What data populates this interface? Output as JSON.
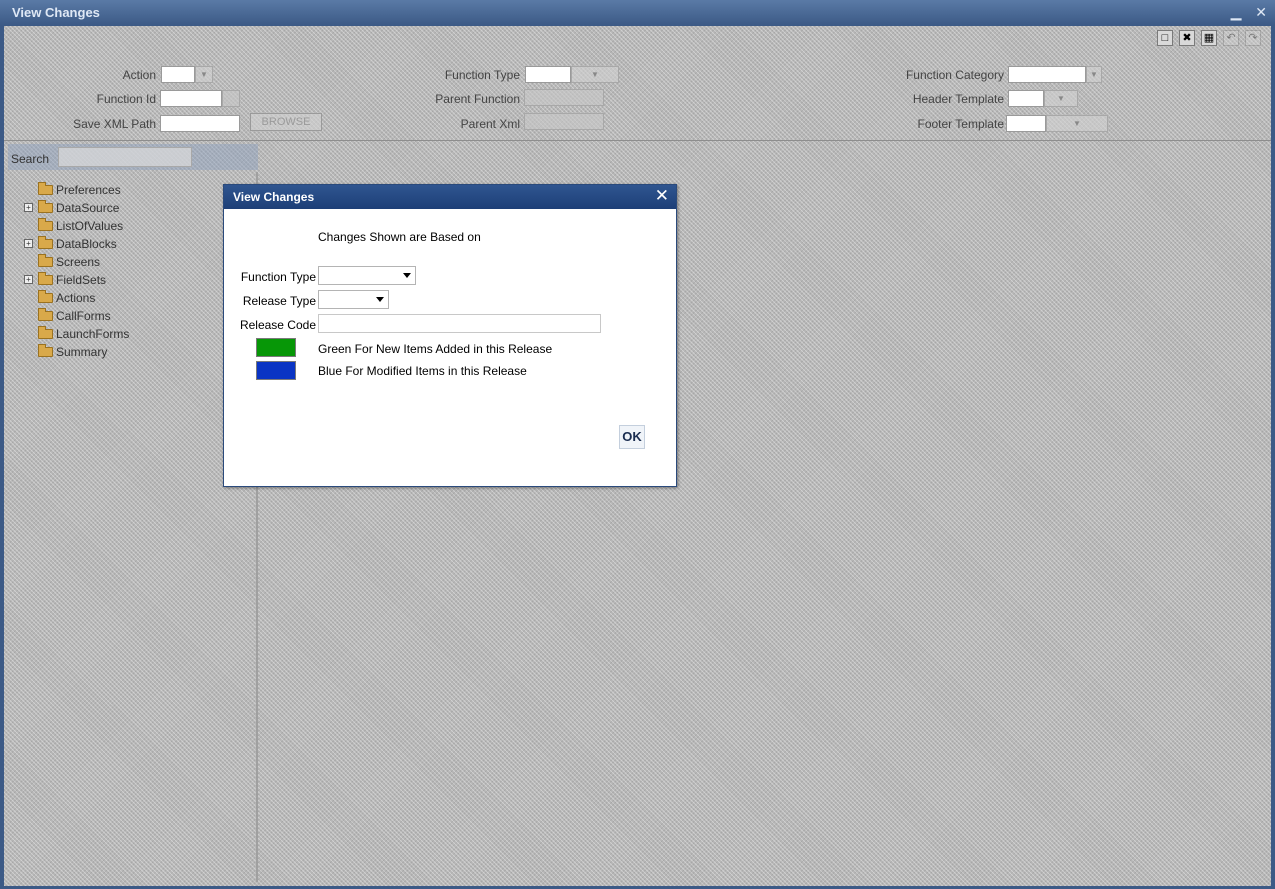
{
  "window": {
    "title": "View Changes"
  },
  "toolbar": {
    "icons": [
      "save-icon",
      "delete-icon",
      "calendar-icon",
      "undo-icon",
      "redo-icon"
    ]
  },
  "form": {
    "action_label": "Action",
    "function_id_label": "Function Id",
    "save_xml_path_label": "Save XML Path",
    "browse_label": "BROWSE",
    "function_type_label": "Function Type",
    "parent_function_label": "Parent Function",
    "parent_xml_label": "Parent Xml",
    "function_category_label": "Function Category",
    "header_template_label": "Header Template",
    "footer_template_label": "Footer Template"
  },
  "search": {
    "label": "Search"
  },
  "tree": {
    "items": [
      {
        "label": "Preferences",
        "expandable": false
      },
      {
        "label": "DataSource",
        "expandable": true
      },
      {
        "label": "ListOfValues",
        "expandable": false
      },
      {
        "label": "DataBlocks",
        "expandable": true
      },
      {
        "label": "Screens",
        "expandable": false
      },
      {
        "label": "FieldSets",
        "expandable": true
      },
      {
        "label": "Actions",
        "expandable": false
      },
      {
        "label": "CallForms",
        "expandable": false
      },
      {
        "label": "LaunchForms",
        "expandable": false
      },
      {
        "label": "Summary",
        "expandable": false
      }
    ]
  },
  "dialog": {
    "title": "View Changes",
    "heading": "Changes Shown are Based on",
    "function_type_label": "Function Type",
    "function_type_value": "",
    "release_type_label": "Release Type",
    "release_type_value": "",
    "release_code_label": "Release Code",
    "release_code_value": "",
    "legend_green_text": "Green For New Items Added in this Release",
    "legend_blue_text": "Blue For Modified Items in this Release",
    "green_color": "#079707",
    "blue_color": "#0a34c4",
    "ok_label": "OK"
  }
}
